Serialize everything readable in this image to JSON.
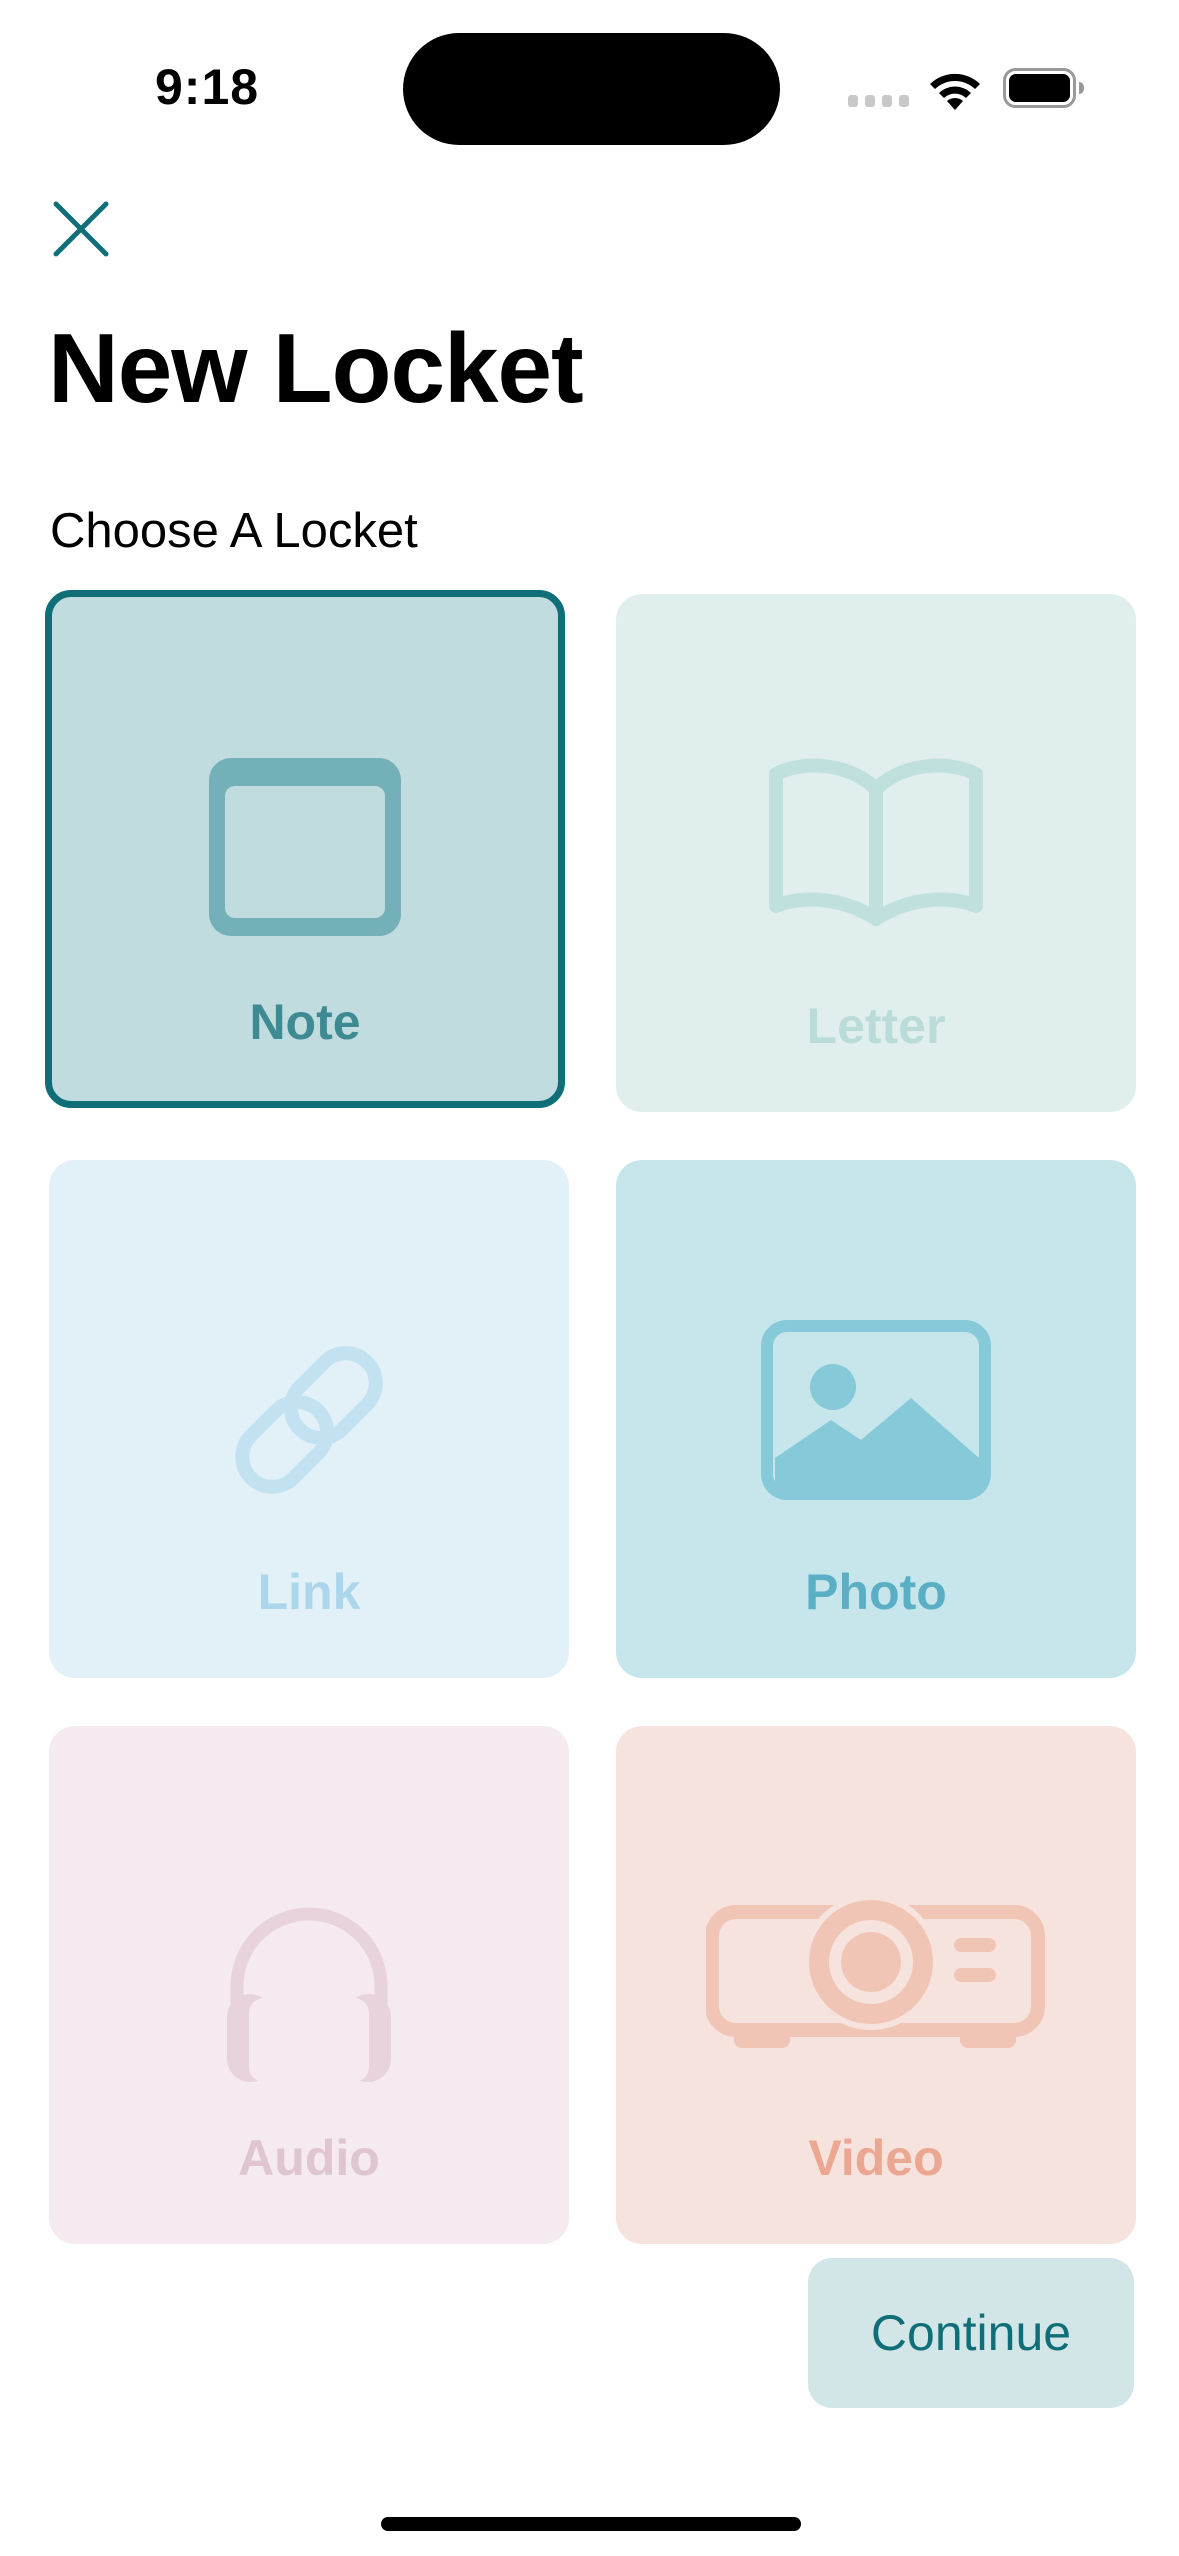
{
  "status_bar": {
    "time": "9:18"
  },
  "header": {
    "title": "New Locket",
    "close_icon": "close-icon"
  },
  "section": {
    "label": "Choose A Locket"
  },
  "tiles": [
    {
      "id": "note",
      "label": "Note",
      "selected": true,
      "icon": "note-window-icon",
      "bg": "#c1dcde",
      "fg": "#73b0b7",
      "label_color": "#3d8a92"
    },
    {
      "id": "letter",
      "label": "Letter",
      "selected": false,
      "icon": "open-book-icon",
      "bg": "#e0efee",
      "fg": "#bfe0dd",
      "label_color": "#b9dcd8"
    },
    {
      "id": "link",
      "label": "Link",
      "selected": false,
      "icon": "link-icon",
      "bg": "#e2f1f8",
      "fg": "#c3e2f1",
      "label_color": "#acd6ec"
    },
    {
      "id": "photo",
      "label": "Photo",
      "selected": false,
      "icon": "photo-icon",
      "bg": "#c6e6ec",
      "fg": "#86c9d8",
      "label_color": "#5aafc4"
    },
    {
      "id": "audio",
      "label": "Audio",
      "selected": false,
      "icon": "headphones-icon",
      "bg": "#f4eaef",
      "fg": "#e8d3dc",
      "label_color": "#dec5d0"
    },
    {
      "id": "video",
      "label": "Video",
      "selected": false,
      "icon": "projector-icon",
      "bg": "#f7e3dd",
      "fg": "#f0c5b6",
      "label_color": "#eba791"
    }
  ],
  "footer": {
    "continue_label": "Continue"
  },
  "colors": {
    "accent": "#0f6e78"
  }
}
